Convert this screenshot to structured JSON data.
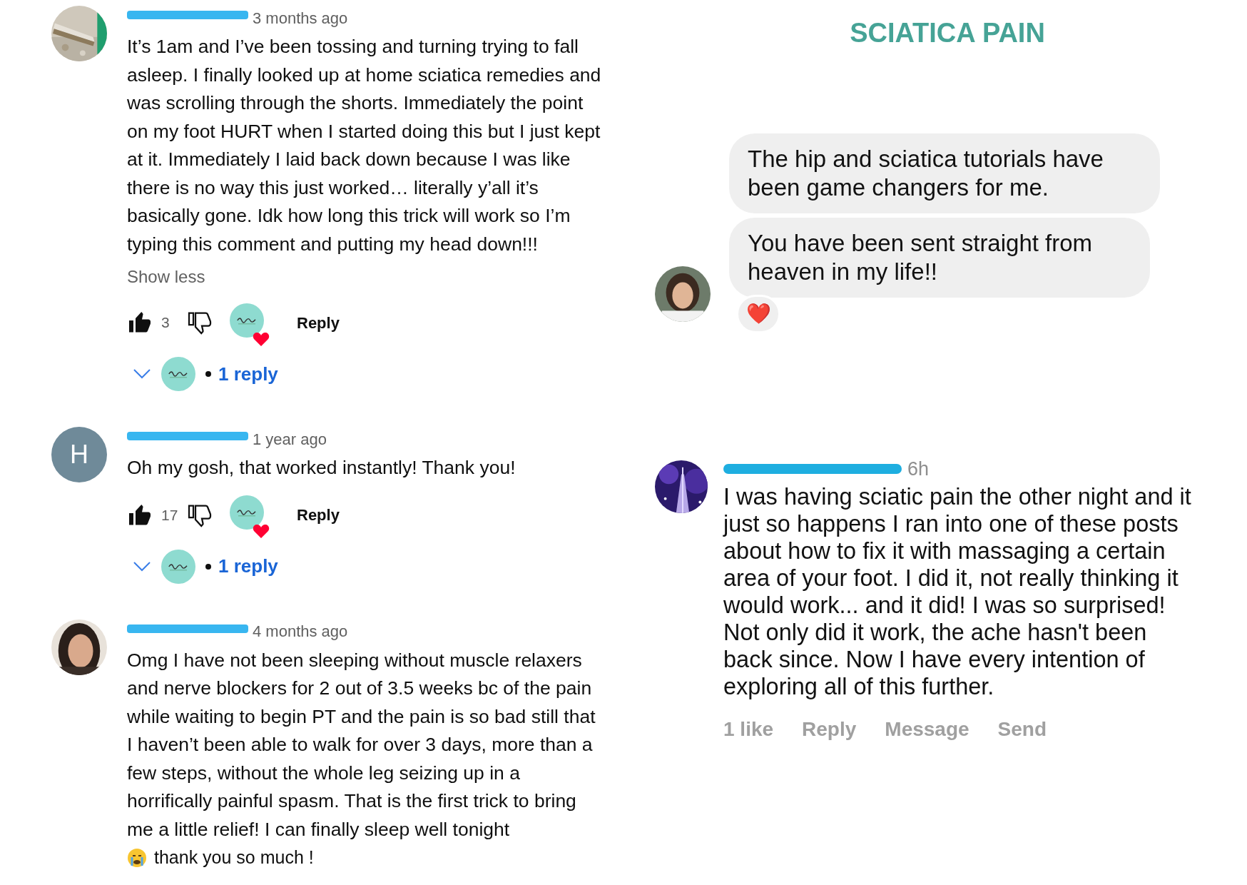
{
  "youtube_comments": [
    {
      "time": "3 months ago",
      "text": "It’s 1am and I’ve been tossing and turning trying to fall asleep. I finally looked up at home sciatica remedies and was scrolling through the shorts. Immediately the point on my foot HURT when I started doing this but I just kept at it. Immediately I laid back down because I was like there is no way this just worked… literally y’all it’s basically gone. Idk how long this trick will work so I’m typing this comment and putting my head down!!!",
      "toggle": "Show less",
      "likes": "3",
      "liked": true,
      "hearted": true,
      "reply_label": "Reply",
      "replies": "1 reply"
    },
    {
      "avatar": {
        "kind": "letter",
        "letter": "H"
      },
      "time": "1 year ago",
      "text": "Oh my gosh, that worked instantly! Thank you!",
      "likes": "17",
      "liked": true,
      "hearted": true,
      "reply_label": "Reply",
      "replies": "1 reply"
    },
    {
      "time": "4 months ago",
      "text": "Omg I have not been sleeping without muscle relaxers and nerve blockers for 2 out of 3.5 weeks bc of the pain while waiting to begin PT and the pain is so bad still that I haven’t been able to walk for over 3 days, more than a few steps, without the whole leg seizing up in a horrifically painful spasm. That is the first trick to bring me a little relief! I can finally sleep well tonight",
      "closing": "thank you so much !"
    }
  ],
  "title": "SCIATICA PAIN",
  "messages": [
    {
      "text": "The hip and sciatica tutorials have been game changers for me."
    },
    {
      "text": "You have been sent straight from heaven in my life!!",
      "reaction": "❤️"
    }
  ],
  "social_comment": {
    "time": "6h",
    "text": "I was having sciatic pain the other night and it just so happens I ran into one of these posts about how to fix it with massaging a certain area of your foot. I did it, not really thinking it would work... and it did! I was so surprised! Not only did it work, the ache hasn't been back since. Now I have every intention of exploring all of this further.",
    "actions": [
      "1 like",
      "Reply",
      "Message",
      "Send"
    ]
  }
}
